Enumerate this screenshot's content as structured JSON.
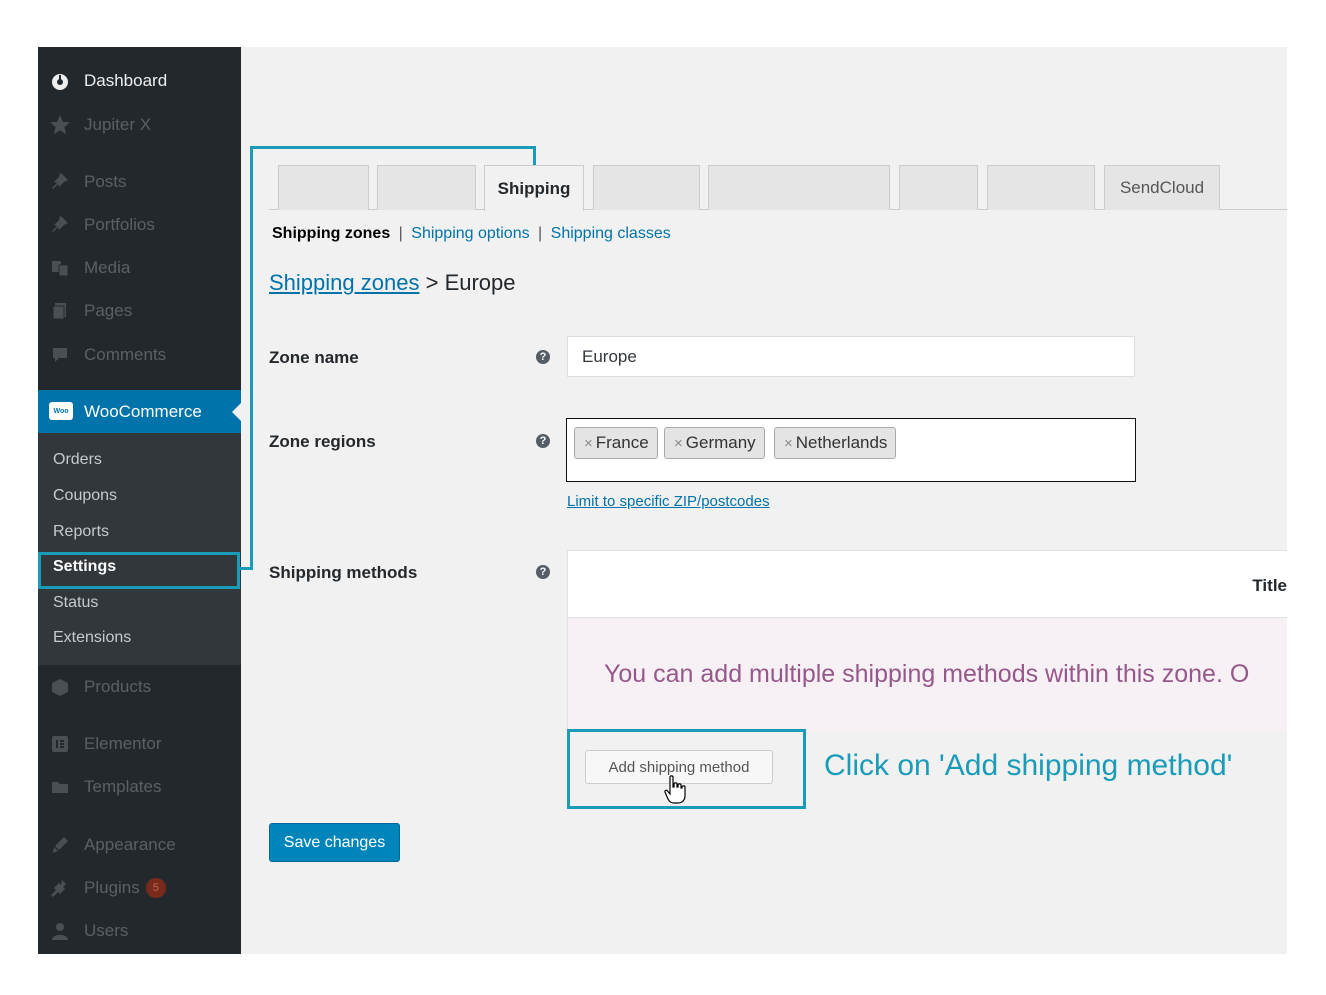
{
  "sidebar": {
    "items": [
      {
        "label": "Dashboard",
        "icon": "dashboard-icon",
        "dim": false
      },
      {
        "label": "Jupiter X",
        "icon": "star-icon",
        "dim": true
      },
      {
        "label": "Posts",
        "icon": "pin-icon",
        "dim": true
      },
      {
        "label": "Portfolios",
        "icon": "pin-icon",
        "dim": true
      },
      {
        "label": "Media",
        "icon": "media-icon",
        "dim": true
      },
      {
        "label": "Pages",
        "icon": "pages-icon",
        "dim": true
      },
      {
        "label": "Comments",
        "icon": "comment-icon",
        "dim": true
      },
      {
        "label": "WooCommerce",
        "icon": "woo-icon",
        "dim": false
      },
      {
        "label": "Products",
        "icon": "box-icon",
        "dim": true
      },
      {
        "label": "Elementor",
        "icon": "elementor-icon",
        "dim": true
      },
      {
        "label": "Templates",
        "icon": "folder-icon",
        "dim": true
      },
      {
        "label": "Appearance",
        "icon": "brush-icon",
        "dim": true
      },
      {
        "label": "Plugins",
        "icon": "plugin-icon",
        "dim": true,
        "badge": "5"
      },
      {
        "label": "Users",
        "icon": "user-icon",
        "dim": true
      }
    ],
    "woo_icon_text": "Woo",
    "submenu": [
      "Orders",
      "Coupons",
      "Reports",
      "Settings",
      "Status",
      "Extensions"
    ],
    "submenu_current": "Settings"
  },
  "tabs": [
    "",
    "",
    "Shipping",
    "",
    "",
    "",
    "",
    "SendCloud"
  ],
  "active_tab": "Shipping",
  "subnav": {
    "current": "Shipping zones",
    "links": [
      "Shipping options",
      "Shipping classes"
    ],
    "separator": "|"
  },
  "breadcrumb": {
    "link": "Shipping zones",
    "separator": ">",
    "current": "Europe"
  },
  "form": {
    "zone_name_label": "Zone name",
    "zone_name_value": "Europe",
    "zone_regions_label": "Zone regions",
    "regions": [
      "France",
      "Germany",
      "Netherlands"
    ],
    "chip_remove": "×",
    "limit_link": "Limit to specific ZIP/postcodes",
    "shipping_methods_label": "Shipping methods",
    "table_header_title": "Title",
    "blank_message": "You can add multiple shipping methods within this zone. O",
    "add_method_button": "Add shipping method",
    "help_glyph": "?"
  },
  "save_button": "Save changes",
  "annotation": {
    "callout": "Click on 'Add shipping method'",
    "color": "#1a9cb8"
  },
  "colors": {
    "sidebar_bg": "#23282d",
    "submenu_bg": "#32373c",
    "wp_blue": "#0073aa",
    "primary_button": "#0085ba",
    "woo_purple": "#96588a"
  }
}
